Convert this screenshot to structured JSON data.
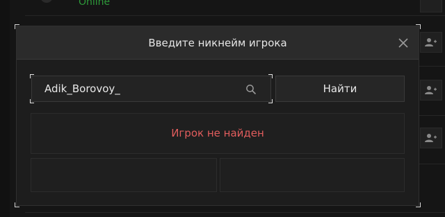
{
  "background": {
    "status_text": "Online",
    "status_color": "#2e9b3a",
    "action_icon": "add-user-icon"
  },
  "modal": {
    "title": "Введите никнейм игрока",
    "close_icon": "close-icon",
    "search": {
      "value": "Adik_Borovoy_",
      "icon": "search-icon"
    },
    "find_button_label": "Найти",
    "result_message": "Игрок не найден",
    "result_color": "#e25d5d"
  }
}
